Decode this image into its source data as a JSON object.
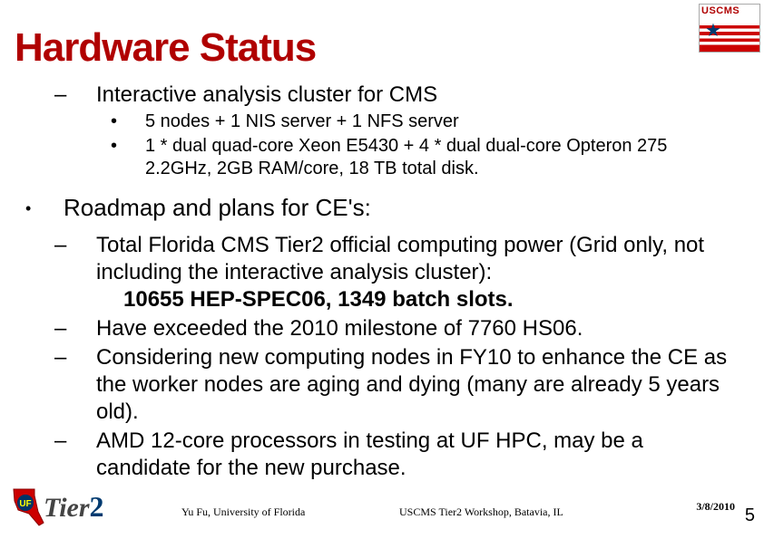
{
  "title": "Hardware Status",
  "logo_uscms_text": "USCMS",
  "section1": {
    "heading": "Interactive analysis cluster for CMS",
    "bullets": [
      "5 nodes + 1 NIS server + 1 NFS server",
      "1 * dual quad-core Xeon E5430 + 4 * dual dual-core Opteron 275 2.2GHz, 2GB RAM/core, 18 TB total disk."
    ]
  },
  "section2": {
    "heading": "Roadmap and plans for CE's:",
    "items": [
      {
        "text": "Total Florida CMS Tier2 official computing power (Grid only, not including the interactive analysis cluster):",
        "spec": "10655 HEP-SPEC06,  1349 batch slots."
      },
      {
        "text": "Have exceeded the 2010 milestone of 7760 HS06."
      },
      {
        "text": "Considering new computing nodes in FY10 to enhance the CE as the worker nodes are aging and dying (many are already 5 years old)."
      },
      {
        "text": "AMD 12-core processors in testing at UF HPC, may be a candidate for the new purchase."
      }
    ]
  },
  "footer": {
    "author": "Yu Fu, University of Florida",
    "event": "USCMS Tier2 Workshop, Batavia, IL",
    "date": "3/8/2010",
    "page": "5",
    "tier_label": "Tier",
    "tier_num": "2"
  }
}
